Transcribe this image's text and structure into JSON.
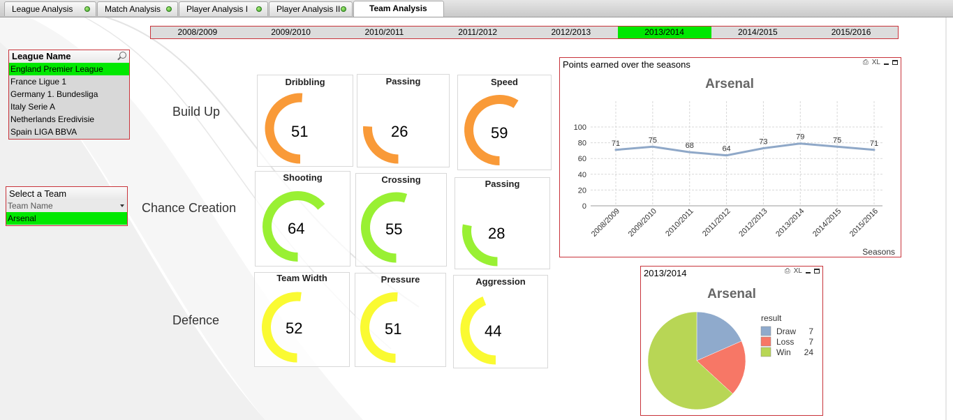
{
  "tabs": [
    {
      "label": "League Analysis"
    },
    {
      "label": "Match Analysis"
    },
    {
      "label": "Player Analysis I"
    },
    {
      "label": "Player Analysis II"
    },
    {
      "label": "Team Analysis"
    }
  ],
  "seasons": [
    "2008/2009",
    "2009/2010",
    "2010/2011",
    "2011/2012",
    "2012/2013",
    "2013/2014",
    "2014/2015",
    "2015/2016"
  ],
  "selected_season": "2013/2014",
  "league_list": {
    "title": "League Name",
    "items": [
      "England Premier League",
      "France Ligue 1",
      "Germany 1. Bundesliga",
      "Italy Serie A",
      "Netherlands Eredivisie",
      "Spain LIGA BBVA"
    ],
    "selected": "England Premier League"
  },
  "team_list": {
    "title": "Select a Team",
    "header": "Team Name",
    "items": [
      "Arsenal"
    ],
    "selected": "Arsenal"
  },
  "rows": {
    "build_up": "Build Up",
    "chance_creation": "Chance Creation",
    "defence": "Defence"
  },
  "gauges": {
    "dribbling": {
      "title": "Dribbling",
      "value": 51
    },
    "build_passing": {
      "title": "Passing",
      "value": 26
    },
    "speed": {
      "title": "Speed",
      "value": 59
    },
    "shooting": {
      "title": "Shooting",
      "value": 64
    },
    "crossing": {
      "title": "Crossing",
      "value": 55
    },
    "chance_passing": {
      "title": "Passing",
      "value": 28
    },
    "team_width": {
      "title": "Team Width",
      "value": 52
    },
    "pressure": {
      "title": "Pressure",
      "value": 51
    },
    "aggression": {
      "title": "Aggression",
      "value": 44
    }
  },
  "colors": {
    "build_up": "#f99a38",
    "chance_creation": "#99f033",
    "defence": "#fafa32",
    "selected": "#00e800",
    "border": "#c8333a",
    "line": "#8fa8c8",
    "draw": "#8faacc",
    "loss": "#f77766",
    "win": "#b8d655"
  },
  "line_panel": {
    "caption": "Points earned over the seasons",
    "tools": "XL"
  },
  "pie_panel": {
    "caption": "2013/2014",
    "tools": "XL"
  },
  "chart_data": [
    {
      "type": "line",
      "title": "Arsenal",
      "xlabel": "Seasons",
      "ylabel": "",
      "categories": [
        "2008/2009",
        "2009/2010",
        "2010/2011",
        "2011/2012",
        "2012/2013",
        "2013/2014",
        "2014/2015",
        "2015/2016"
      ],
      "series": [
        {
          "values": [
            71,
            75,
            68,
            64,
            73,
            79,
            75,
            71
          ]
        }
      ],
      "ylim": [
        0,
        100
      ],
      "yticks": [
        0,
        20,
        40,
        60,
        80,
        100
      ],
      "grid": true
    },
    {
      "type": "pie",
      "title": "Arsenal",
      "legend_title": "result",
      "legend_position": "right",
      "labels": [
        "Draw",
        "Loss",
        "Win"
      ],
      "values": [
        7,
        7,
        24
      ]
    }
  ]
}
